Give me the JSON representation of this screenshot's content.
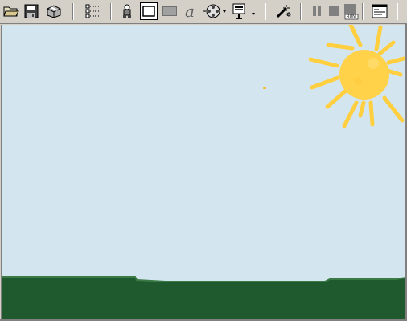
{
  "toolbar": {
    "buttons": [
      {
        "name": "open-folder-icon"
      },
      {
        "name": "save-disk-icon"
      },
      {
        "name": "package-icon"
      },
      {
        "name": "tree-view-icon"
      },
      {
        "name": "sprite-character-icon"
      },
      {
        "name": "frame-rectangle-icon"
      },
      {
        "name": "filled-rectangle-icon"
      },
      {
        "name": "text-tool-icon"
      },
      {
        "name": "film-reel-icon"
      },
      {
        "name": "actor-stack-icon"
      },
      {
        "name": "magic-wand-icon"
      },
      {
        "name": "pause-icon"
      },
      {
        "name": "stop-icon"
      },
      {
        "name": "run-icon"
      },
      {
        "name": "window-preview-icon"
      }
    ],
    "run_label": "RUN"
  },
  "stage": {
    "sky_color": "#d3e6ef",
    "grass_color": "#1f5a2e",
    "grass_edge_color": "#3a7a45",
    "sun_color": "#ffd24a",
    "sun_ray_color": "#ffcf3f"
  }
}
